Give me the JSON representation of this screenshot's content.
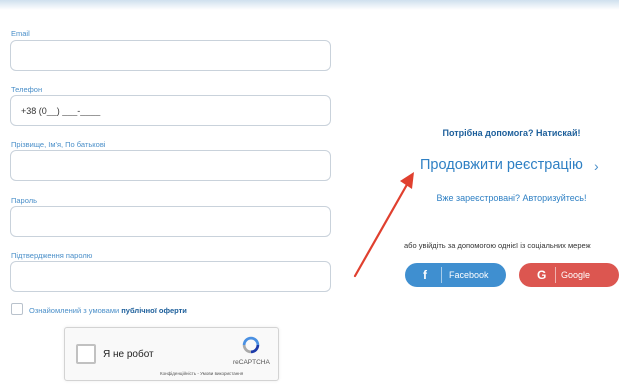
{
  "form": {
    "email_label": "Email",
    "email_value": "",
    "phone_label": "Телефон",
    "phone_value": "+38 (0__) ___-____",
    "name_label": "Прізвище, Ім'я, По батькові",
    "name_value": "",
    "password_label": "Пароль",
    "password_value": "",
    "confirm_label": "Підтвердження паролю",
    "confirm_value": "",
    "agree_prefix": "Ознайомлений з умовами",
    "agree_link": "публічної оферти"
  },
  "captcha": {
    "label": "Я не робот",
    "brand": "reCAPTCHA",
    "legal": "Конфіденційність - Умови використання"
  },
  "side": {
    "help": "Потрібна допомога? Натискай!",
    "continue": "Продовжити реєстрацію",
    "continue_chevron": "›",
    "login": "Вже зареєстровані? Авторизуйтесь!",
    "social_prompt": "або увійдіть за допомогою однієї із соціальних мереж"
  },
  "social": {
    "facebook_icon": "f",
    "facebook_label": "Facebook",
    "google_icon": "G",
    "google_label": "Google"
  },
  "colors": {
    "link_blue": "#2f80c4",
    "facebook": "#3f8fd0",
    "google": "#dc5650",
    "arrow": "#e0402f"
  }
}
